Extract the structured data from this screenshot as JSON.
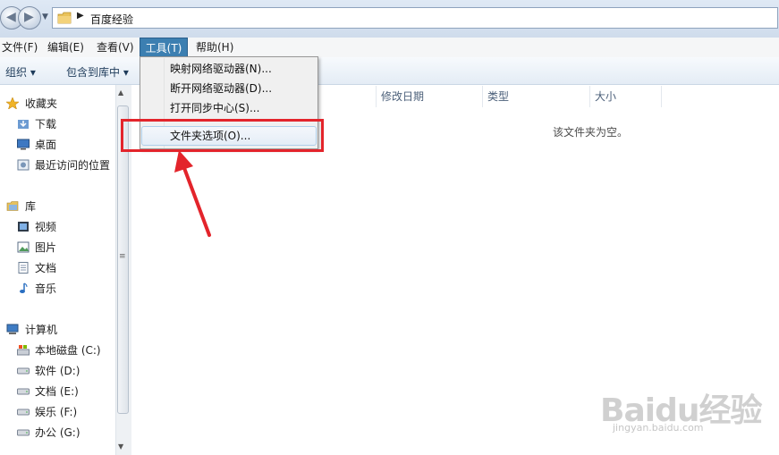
{
  "address": {
    "path": "百度经验"
  },
  "menubar": {
    "file": "文件(F)",
    "edit": "编辑(E)",
    "view": "查看(V)",
    "tools": "工具(T)",
    "help": "帮助(H)"
  },
  "toolbar": {
    "organize": "组织 ▾",
    "include_in_library": "包含到库中 ▾"
  },
  "columns": {
    "modified": "修改日期",
    "type": "类型",
    "size": "大小"
  },
  "empty_message": "该文件夹为空。",
  "tools_menu": {
    "map_drive": "映射网络驱动器(N)...",
    "disconnect_drive": "断开网络驱动器(D)...",
    "sync_center": "打开同步中心(S)...",
    "folder_options": "文件夹选项(O)..."
  },
  "nav": {
    "favorites": {
      "header": "收藏夹",
      "items": [
        "下载",
        "桌面",
        "最近访问的位置"
      ]
    },
    "libraries": {
      "header": "库",
      "items": [
        "视频",
        "图片",
        "文档",
        "音乐"
      ]
    },
    "computer": {
      "header": "计算机",
      "items": [
        "本地磁盘 (C:)",
        "软件 (D:)",
        "文档 (E:)",
        "娱乐 (F:)",
        "办公 (G:)"
      ]
    }
  },
  "watermark": {
    "logo": "Baidu经验",
    "url": "jingyan.baidu.com"
  },
  "colors": {
    "menu_highlight": "#3c7fb1",
    "annotation": "#e3242b"
  }
}
